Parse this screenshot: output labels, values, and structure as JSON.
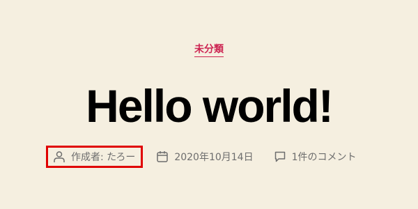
{
  "colors": {
    "background": "#f5efe0",
    "accent": "#cd2653",
    "meta_text": "#6d6d6d",
    "highlight_box": "#e00000"
  },
  "post": {
    "category": "未分類",
    "title": "Hello world!",
    "meta": {
      "author": {
        "icon": "user-icon",
        "text": "作成者: たろー"
      },
      "date": {
        "icon": "calendar-icon",
        "text": "2020年10月14日"
      },
      "comments": {
        "icon": "comment-icon",
        "text": "1件のコメント"
      }
    }
  }
}
